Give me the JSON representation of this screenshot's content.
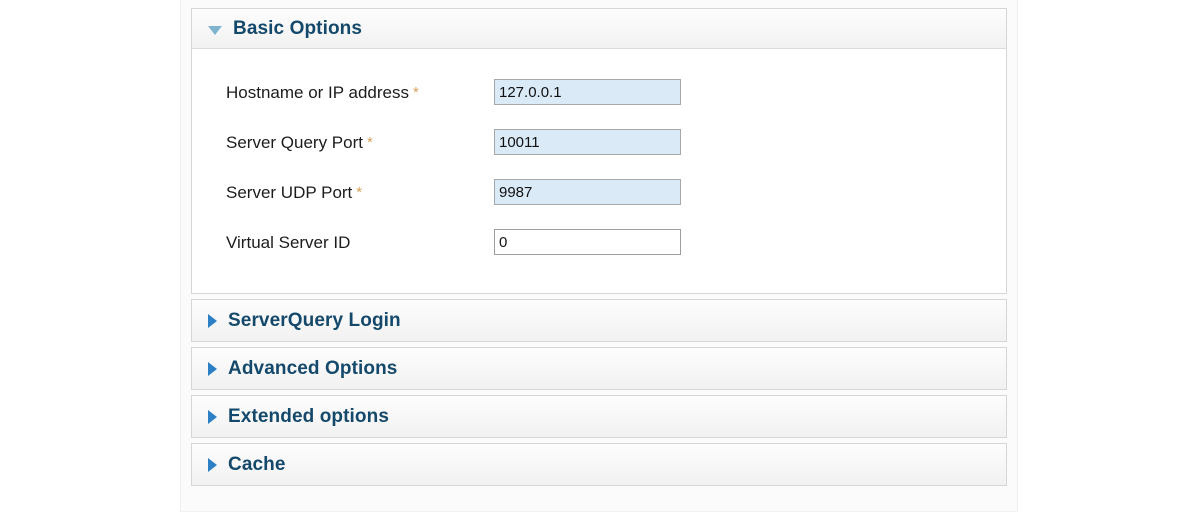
{
  "colors": {
    "panel_title": "#15496b",
    "required_star": "#d8a15a",
    "input_filled_bg": "#dbeaf7",
    "input_plain_bg": "#ffffff",
    "arrow_open": "#7fb4cf",
    "arrow_closed": "#2b7fc4"
  },
  "sections": [
    {
      "id": "basic-options",
      "title": "Basic Options",
      "expanded": true,
      "toggle_icon": "triangle-down-icon",
      "fields": [
        {
          "id": "hostname",
          "label": "Hostname or IP address",
          "required": true,
          "required_marker": "*",
          "value": "127.0.0.1",
          "placeholder": "",
          "filled": true
        },
        {
          "id": "server-query-port",
          "label": "Server Query Port",
          "required": true,
          "required_marker": "*",
          "value": "10011",
          "placeholder": "",
          "filled": true
        },
        {
          "id": "server-udp-port",
          "label": "Server UDP Port",
          "required": true,
          "required_marker": "*",
          "value": "9987",
          "placeholder": "",
          "filled": true
        },
        {
          "id": "virtual-server-id",
          "label": "Virtual Server ID",
          "required": false,
          "required_marker": "",
          "value": "0",
          "placeholder": "",
          "filled": false
        }
      ]
    },
    {
      "id": "serverquery-login",
      "title": "ServerQuery Login",
      "expanded": false,
      "toggle_icon": "triangle-right-icon",
      "fields": []
    },
    {
      "id": "advanced-options",
      "title": "Advanced Options",
      "expanded": false,
      "toggle_icon": "triangle-right-icon",
      "fields": []
    },
    {
      "id": "extended-options",
      "title": "Extended options",
      "expanded": false,
      "toggle_icon": "triangle-right-icon",
      "fields": []
    },
    {
      "id": "cache",
      "title": "Cache",
      "expanded": false,
      "toggle_icon": "triangle-right-icon",
      "fields": []
    }
  ]
}
